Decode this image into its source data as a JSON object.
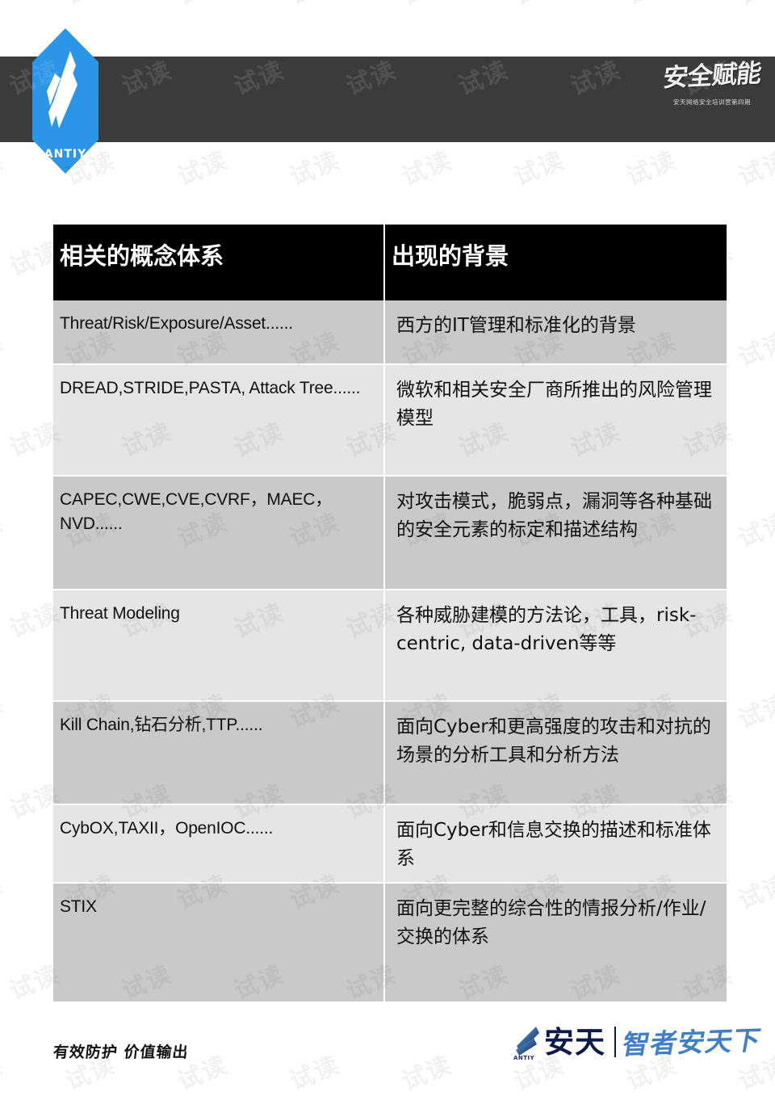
{
  "header": {
    "logo_alt": "ANTIY",
    "logo_wordmark": "ANTIY",
    "calligraphy_mark": "安全赋能",
    "calligraphy_sub": "安天网络安全培训营第四期"
  },
  "watermark": {
    "text": "试读"
  },
  "table": {
    "columns": [
      {
        "label": "相关的概念体系"
      },
      {
        "label": "出现的背景"
      }
    ],
    "rows": [
      {
        "concept": "Threat/Risk/Exposure/Asset......",
        "background": "西方的IT管理和标准化的背景"
      },
      {
        "concept": "DREAD,STRIDE,PASTA, Attack Tree......",
        "background": "微软和相关安全厂商所推出的风险管理模型"
      },
      {
        "concept": "CAPEC,CWE,CVE,CVRF，MAEC，NVD......",
        "background": "对攻击模式，脆弱点，漏洞等各种基础的安全元素的标定和描述结构"
      },
      {
        "concept": "Threat Modeling",
        "background": "各种威胁建模的方法论，工具，risk-centric, data-driven等等"
      },
      {
        "concept": "Kill Chain,钻石分析,TTP......",
        "background": "面向Cyber和更高强度的攻击和对抗的场景的分析工具和分析方法"
      },
      {
        "concept": "CybOX,TAXII，OpenIOC......",
        "background": "面向Cyber和信息交换的描述和标准体系"
      },
      {
        "concept": "STIX",
        "background": "面向更完整的综合性的情报分析/作业/交换的体系"
      }
    ]
  },
  "footer": {
    "tagline": "有效防护 价值输出",
    "brand_mark_word": "ANTIY",
    "brand_name": "安天",
    "brand_slogan": "智者安天下"
  },
  "colors": {
    "header_band": "#3b3b3b",
    "logo_blue": "#2b95e8",
    "table_header_bg": "#000000",
    "row_dark": "#c9c9c9",
    "row_light": "#e5e5e5",
    "brand_navy": "#0d1b4c",
    "brand_blue": "#3f7fc8"
  }
}
